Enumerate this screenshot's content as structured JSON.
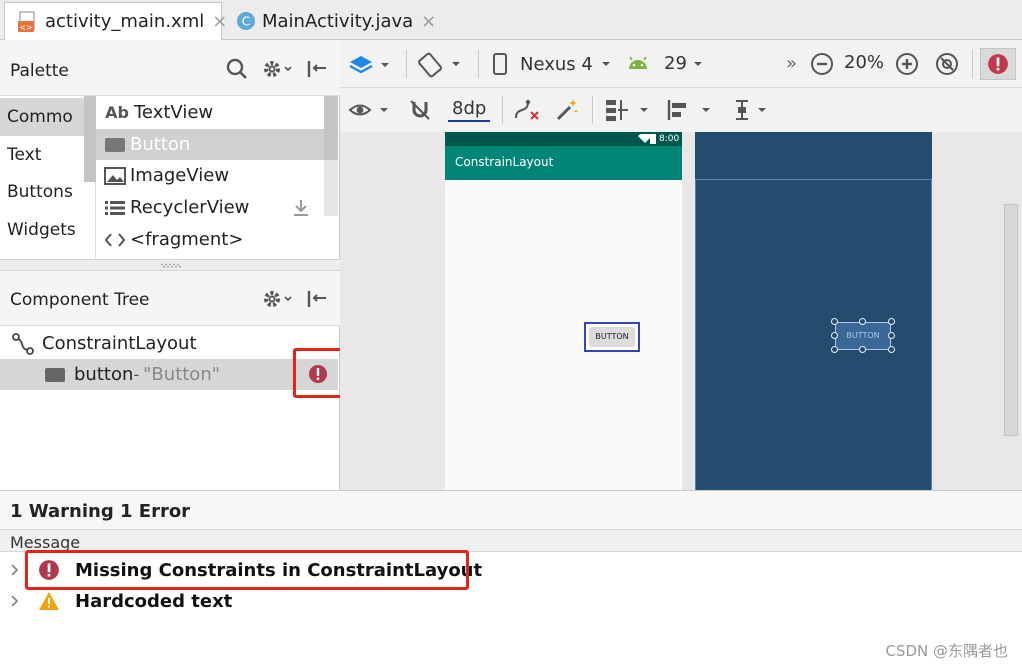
{
  "tabs": [
    {
      "label": "activity_main.xml",
      "close": "×"
    },
    {
      "label": "MainActivity.java",
      "close": "×"
    }
  ],
  "palette": {
    "title": "Palette",
    "categories": [
      "Commo",
      "Text",
      "Buttons",
      "Widgets"
    ],
    "items": [
      {
        "label": "TextView",
        "icon": "textview-icon"
      },
      {
        "label": "Button",
        "icon": "button-icon"
      },
      {
        "label": "ImageView",
        "icon": "image-icon"
      },
      {
        "label": "RecyclerView",
        "icon": "list-icon"
      },
      {
        "label": "<fragment>",
        "icon": "code-icon"
      }
    ],
    "textview_glyph": "Ab"
  },
  "component_tree": {
    "title": "Component Tree",
    "root": "ConstraintLayout",
    "child_id": "button",
    "child_sep": "- ",
    "child_text": "\"Button\""
  },
  "toolbar": {
    "device": "Nexus 4",
    "api": "29",
    "overflow": "»",
    "zoom": "20%",
    "margin": "8dp"
  },
  "phone": {
    "status_time": "8:00",
    "app_title": "ConstrainLayout",
    "button_label": "BUTTON"
  },
  "blueprint": {
    "button_label": "BUTTON"
  },
  "issues": {
    "summary": "1 Warning 1 Error",
    "column": "Message",
    "items": [
      {
        "severity": "error",
        "text": "Missing Constraints in ConstraintLayout"
      },
      {
        "severity": "warning",
        "text": "Hardcoded text"
      }
    ]
  },
  "watermark": "CSDN @东隅者也",
  "colors": {
    "error": "#b1394f",
    "warning": "#f0a30a",
    "highlight": "#e5231b",
    "appbar": "#008577",
    "blueprint": "#244c6e",
    "accent": "#1e88e5"
  }
}
